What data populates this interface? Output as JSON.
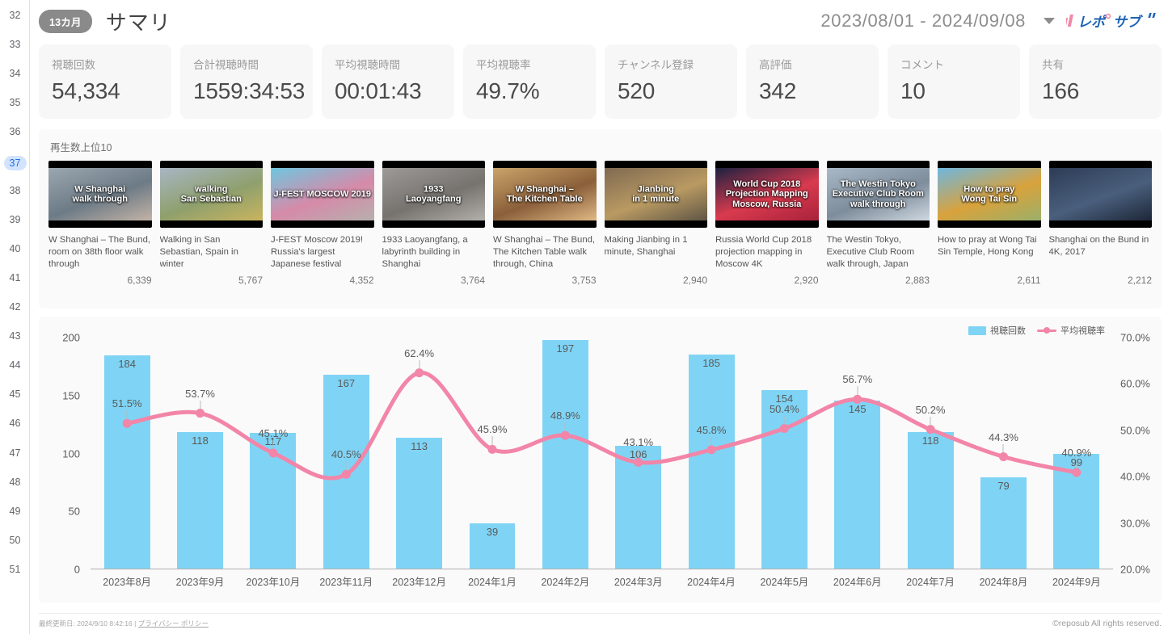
{
  "gutter": {
    "rows": [
      "32",
      "33",
      "34",
      "35",
      "36",
      "37",
      "38",
      "39",
      "40",
      "41",
      "42",
      "43",
      "44",
      "45",
      "46",
      "47",
      "48",
      "49",
      "50",
      "51"
    ],
    "active": "37"
  },
  "header": {
    "period_badge": "13カ月",
    "title": "サマリ",
    "date_range": "2023/08/01 - 2024/09/08",
    "logo_text": "レポサブ",
    "caret_icon": "chevron-down-icon"
  },
  "kpis": [
    {
      "label": "視聴回数",
      "value": "54,334"
    },
    {
      "label": "合計視聴時間",
      "value": "1559:34:53"
    },
    {
      "label": "平均視聴時間",
      "value": "00:01:43"
    },
    {
      "label": "平均視聴率",
      "value": "49.7%"
    },
    {
      "label": "チャンネル登録",
      "value": "520"
    },
    {
      "label": "高評価",
      "value": "342"
    },
    {
      "label": "コメント",
      "value": "10"
    },
    {
      "label": "共有",
      "value": "166"
    }
  ],
  "videos": {
    "section_title": "再生数上位10",
    "items": [
      {
        "title": "W Shanghai – The Bund, room on 38th floor walk through",
        "views": "6,339",
        "overlay": "W Shanghai\nwalk through",
        "c1": "#9aa7b0",
        "c2": "#6d7b86",
        "c3": "#c4b3a6"
      },
      {
        "title": "Walking in San Sebastian, Spain in winter",
        "views": "5,767",
        "overlay": "walking\nSan Sebastian",
        "c1": "#a8b6c4",
        "c2": "#8fa06d",
        "c3": "#c9b45e"
      },
      {
        "title": "J-FEST Moscow 2019! Russia's largest Japanese festival",
        "views": "4,352",
        "overlay": "J-FEST MOSCOW 2019",
        "c1": "#6fc6e0",
        "c2": "#d68aa8",
        "c3": "#b6b0ae"
      },
      {
        "title": "1933 Laoyangfang, a labyrinth building in Shanghai",
        "views": "3,764",
        "overlay": "1933\nLaoyangfang",
        "c1": "#9d9a97",
        "c2": "#76736f",
        "c3": "#b3b0ac"
      },
      {
        "title": "W Shanghai – The Bund, The Kitchen Table walk through, China",
        "views": "3,753",
        "overlay": "W Shanghai –\nThe Kitchen Table",
        "c1": "#caa36a",
        "c2": "#8a5f3a",
        "c3": "#e0b884"
      },
      {
        "title": "Making Jianbing in 1 minute, Shanghai",
        "views": "2,940",
        "overlay": "Jianbing\nin 1 minute",
        "c1": "#7f6a52",
        "c2": "#b99a62",
        "c3": "#5e5545"
      },
      {
        "title": "Russia World Cup 2018 projection mapping in Moscow 4K",
        "views": "2,920",
        "overlay": "World Cup 2018\nProjection Mapping\nMoscow, Russia",
        "c1": "#1b2140",
        "c2": "#d93a4e",
        "c3": "#a8223b"
      },
      {
        "title": "The Westin Tokyo, Executive Club Room walk through, Japan",
        "views": "2,883",
        "overlay": "The Westin Tokyo\nExecutive Club Room\nwalk through",
        "c1": "#a9b8c6",
        "c2": "#7e8d9c",
        "c3": "#cfd8e0"
      },
      {
        "title": "How to pray at Wong Tai Sin Temple, Hong Kong",
        "views": "2,611",
        "overlay": "How to pray\nWong Tai Sin",
        "c1": "#6fb7e0",
        "c2": "#d9a23c",
        "c3": "#9ab06a"
      },
      {
        "title": "Shanghai on the Bund in 4K, 2017",
        "views": "2,212",
        "overlay": "",
        "c1": "#2d3c55",
        "c2": "#4a5f7d",
        "c3": "#1d2738"
      }
    ]
  },
  "chart_data": {
    "type": "bar",
    "title": "",
    "xlabel": "",
    "ylabel": "",
    "grid": false,
    "legend_position": "top-right",
    "categories": [
      "2023年8月",
      "2023年9月",
      "2023年10月",
      "2023年11月",
      "2023年12月",
      "2024年1月",
      "2024年2月",
      "2024年3月",
      "2024年4月",
      "2024年5月",
      "2024年6月",
      "2024年7月",
      "2024年8月",
      "2024年9月"
    ],
    "series": [
      {
        "name": "視聴回数",
        "type": "bar",
        "axis": "left",
        "color": "#7fd4f5",
        "values": [
          184,
          118,
          117,
          167,
          113,
          39,
          197,
          106,
          185,
          154,
          145,
          118,
          79,
          99
        ]
      },
      {
        "name": "平均視聴率",
        "type": "line",
        "axis": "right",
        "color": "#f285a8",
        "values": [
          51.5,
          53.7,
          45.1,
          40.5,
          62.4,
          45.9,
          48.9,
          43.1,
          45.8,
          50.4,
          56.7,
          50.2,
          44.3,
          40.9
        ],
        "value_labels": [
          "51.5%",
          "53.7%",
          "45.1%",
          "40.5%",
          "62.4%",
          "45.9%",
          "48.9%",
          "43.1%",
          "45.8%",
          "50.4%",
          "56.7%",
          "50.2%",
          "44.3%",
          "40.9%"
        ]
      }
    ],
    "yaxis_left": {
      "ticks": [
        "0",
        "50",
        "100",
        "150",
        "200"
      ],
      "values": [
        0,
        50,
        100,
        150,
        200
      ],
      "min": 0,
      "max": 200
    },
    "yaxis_right": {
      "ticks": [
        "20.0%",
        "30.0%",
        "40.0%",
        "50.0%",
        "60.0%",
        "70.0%"
      ],
      "values": [
        20,
        30,
        40,
        50,
        60,
        70
      ],
      "min": 20,
      "max": 70
    }
  },
  "footer": {
    "updated": "最終更新日: 2024/9/10 8:42:16",
    "separator": "|",
    "privacy_link": "プライバシー ポリシー",
    "copyright": "©reposub All rights reserved."
  }
}
